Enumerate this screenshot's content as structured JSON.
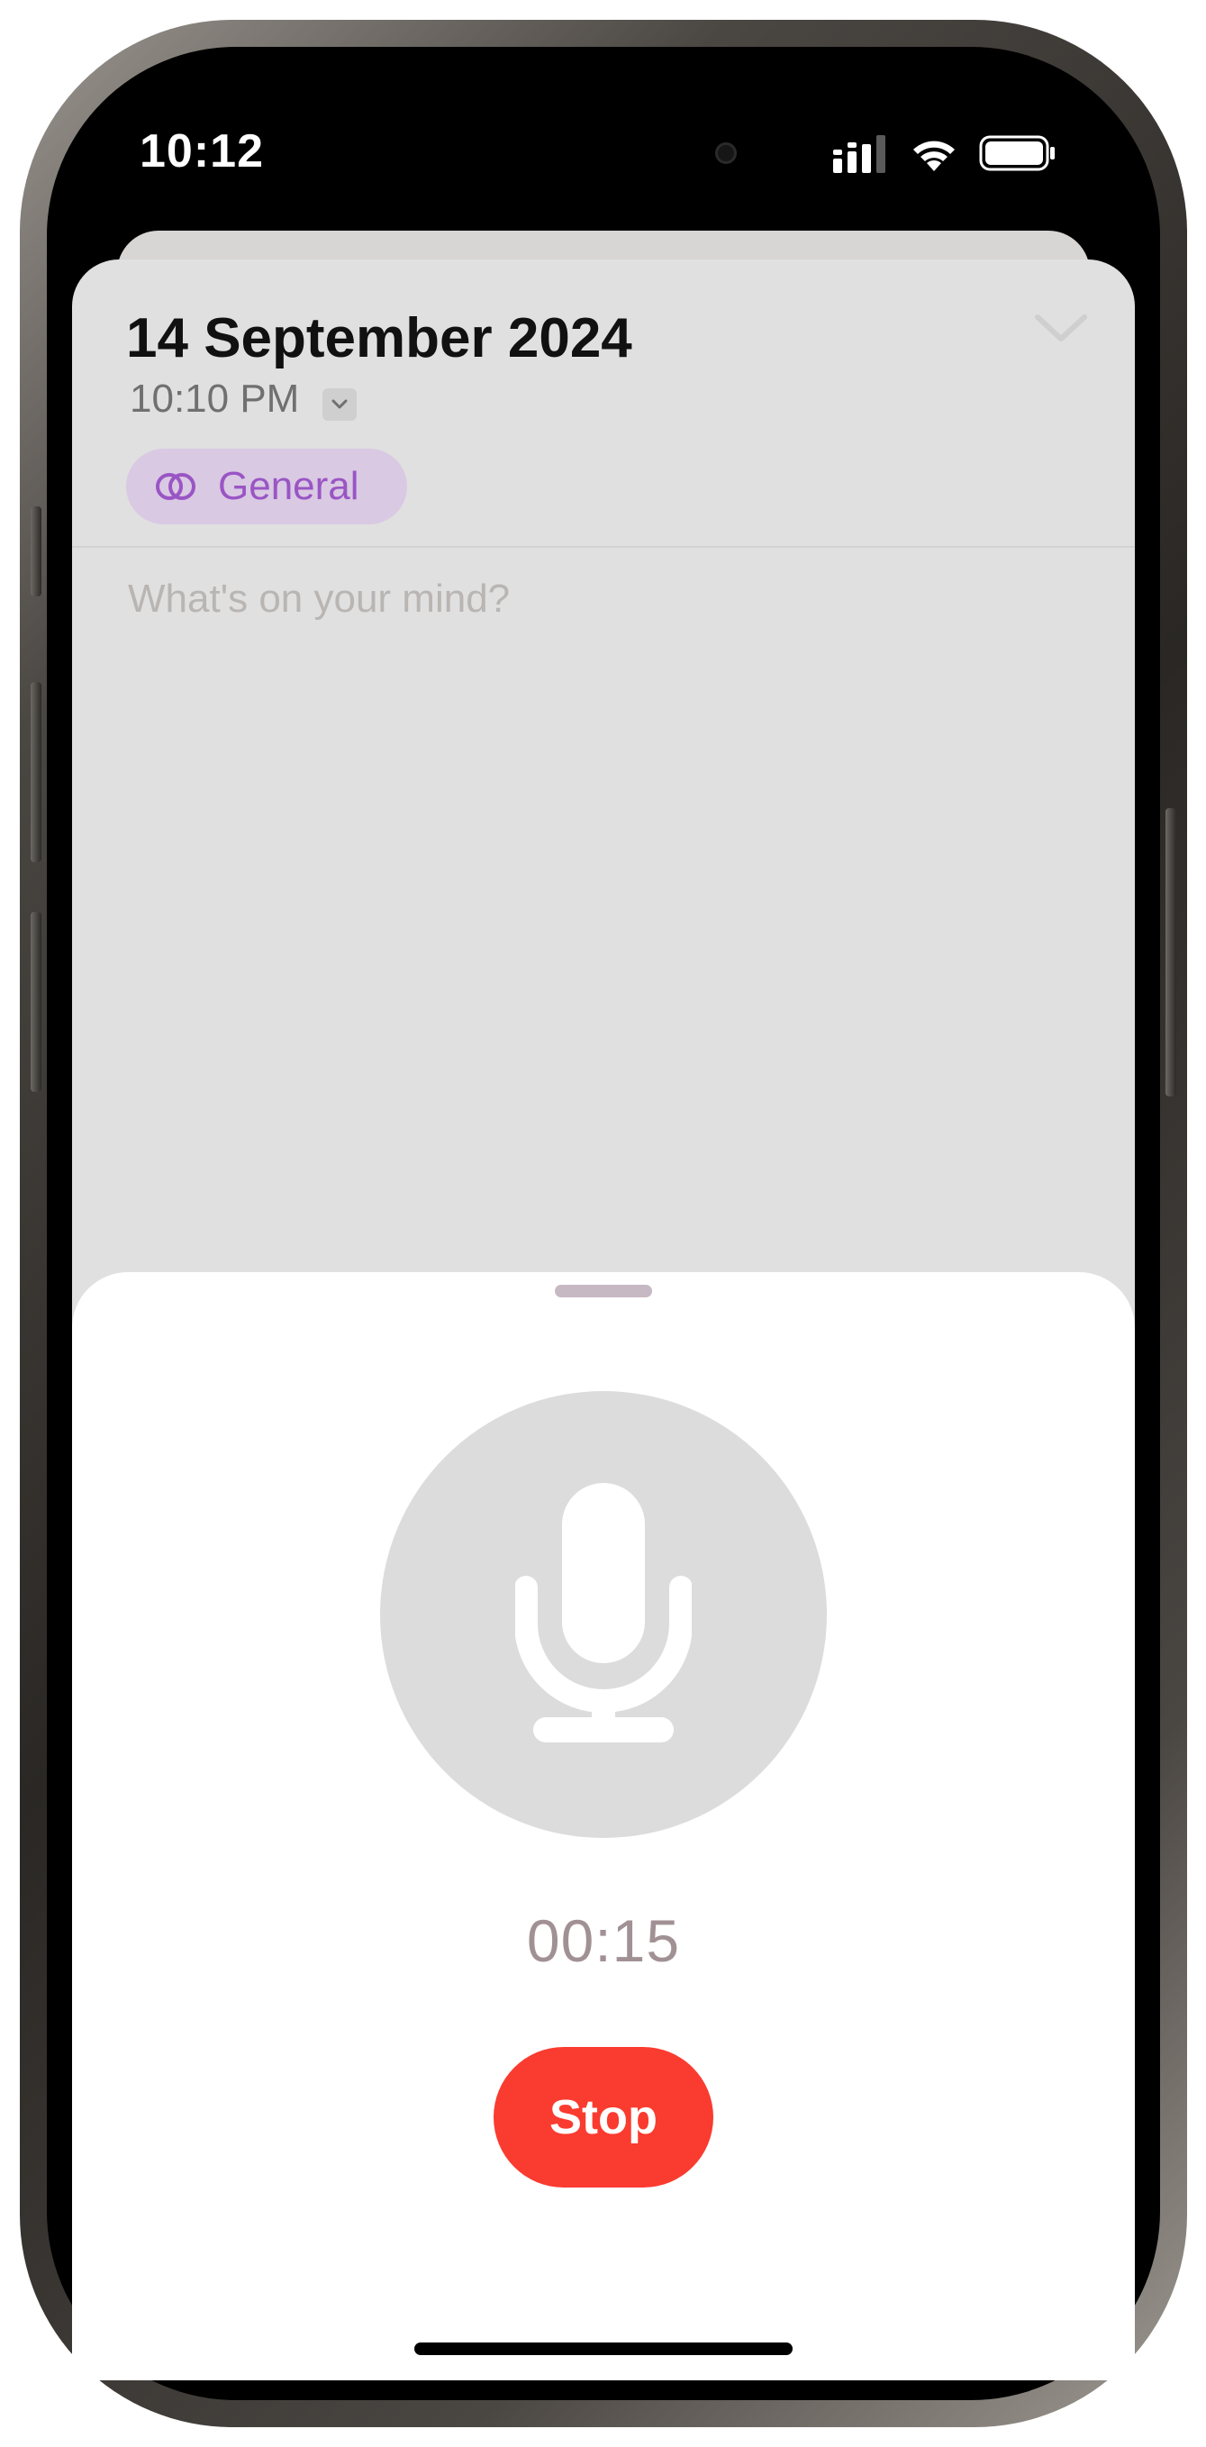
{
  "status_bar": {
    "time": "10:12",
    "signal_icon": "cellular-signal-icon",
    "wifi_icon": "wifi-icon",
    "battery_icon": "battery-icon"
  },
  "entry": {
    "date": "14 September 2024",
    "time": "10:10 PM",
    "category": {
      "label": "General",
      "icon": "toggle-circles-icon",
      "color": "#9a55c4"
    },
    "placeholder": "What's on your mind?"
  },
  "recording": {
    "timer": "00:15",
    "stop_label": "Stop",
    "stop_color": "#fa3b2f",
    "mic_icon": "microphone-icon"
  }
}
